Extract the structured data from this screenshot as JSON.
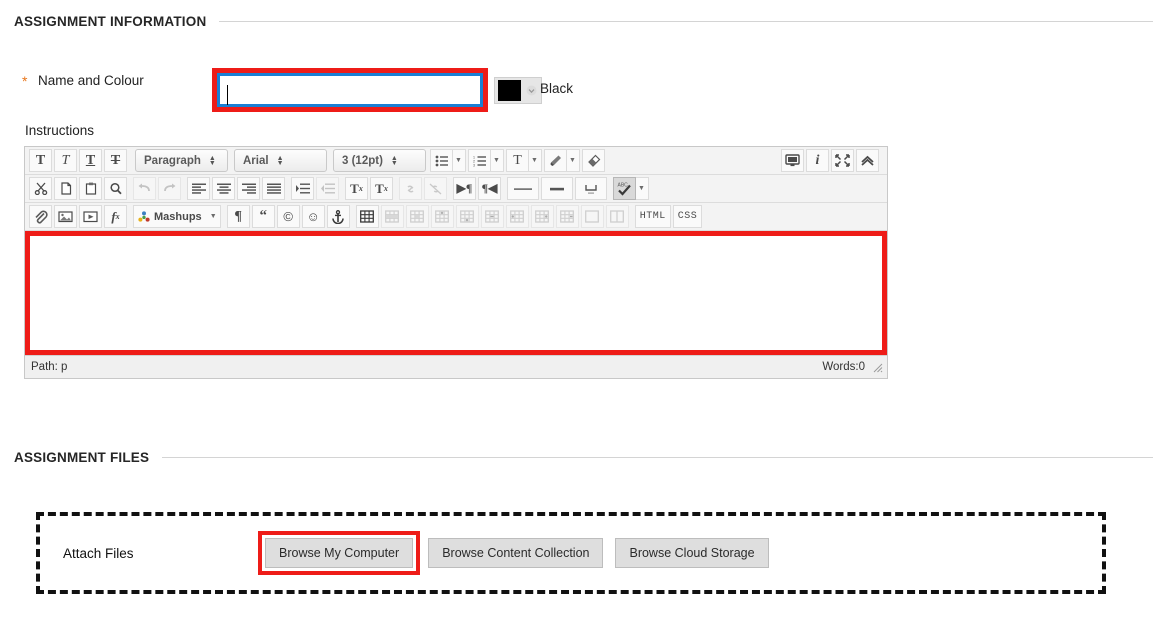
{
  "sections": {
    "assignment_information": "ASSIGNMENT INFORMATION",
    "assignment_files": "ASSIGNMENT FILES"
  },
  "name_field": {
    "required_marker": "*",
    "label": "Name and Colour",
    "value": "",
    "placeholder": ""
  },
  "color_picker": {
    "swatch_color": "#000000",
    "selected_label": "Black",
    "caret_icon": "chevron-down-icon"
  },
  "instructions": {
    "label": "Instructions"
  },
  "editor": {
    "row1": {
      "format_buttons": [
        {
          "name": "bold-icon",
          "glyph": "T"
        },
        {
          "name": "italic-icon",
          "glyph": "T"
        },
        {
          "name": "underline-icon",
          "glyph": "T"
        },
        {
          "name": "strikethrough-icon",
          "glyph": "T"
        }
      ],
      "paragraph_select": "Paragraph",
      "font_select": "Arial",
      "size_select": "3 (12pt)",
      "list_buttons": [
        {
          "name": "bullet-list-icon"
        },
        {
          "name": "numbered-list-icon"
        },
        {
          "name": "text-color-icon",
          "glyph": "T"
        },
        {
          "name": "highlighter-icon"
        },
        {
          "name": "eraser-icon"
        }
      ],
      "right_buttons": [
        {
          "name": "preview-monitor-icon"
        },
        {
          "name": "info-icon",
          "glyph": "i"
        },
        {
          "name": "fullscreen-icon"
        },
        {
          "name": "collapse-chevron-up-icon"
        }
      ]
    },
    "row2": {
      "buttons": [
        {
          "name": "cut-scissors-icon"
        },
        {
          "name": "copy-page-icon"
        },
        {
          "name": "paste-clipboard-icon"
        },
        {
          "name": "find-search-icon"
        },
        {
          "name": "undo-icon"
        },
        {
          "name": "redo-icon"
        },
        {
          "name": "align-left-icon"
        },
        {
          "name": "align-center-icon"
        },
        {
          "name": "align-right-icon"
        },
        {
          "name": "align-justify-icon"
        },
        {
          "name": "indent-icon"
        },
        {
          "name": "outdent-icon"
        },
        {
          "name": "superscript-icon"
        },
        {
          "name": "subscript-icon"
        },
        {
          "name": "insert-link-icon"
        },
        {
          "name": "remove-link-icon"
        },
        {
          "name": "ltr-direction-icon"
        },
        {
          "name": "rtl-direction-icon"
        },
        {
          "name": "horizontal-rule-icon"
        },
        {
          "name": "em-dash-icon"
        },
        {
          "name": "nonbreaking-space-icon"
        },
        {
          "name": "spellcheck-abc-icon"
        }
      ]
    },
    "row3": {
      "buttons": [
        {
          "name": "attach-paperclip-icon"
        },
        {
          "name": "insert-image-icon"
        },
        {
          "name": "insert-video-icon"
        },
        {
          "name": "math-formula-icon"
        }
      ],
      "mashups_label": "Mashups",
      "symbol_buttons": [
        {
          "name": "pilcrow-icon"
        },
        {
          "name": "blockquote-icon"
        },
        {
          "name": "copyright-icon"
        },
        {
          "name": "emoticon-icon"
        },
        {
          "name": "anchor-icon"
        }
      ],
      "table_buttons": [
        {
          "name": "insert-table-icon",
          "enabled": true
        },
        {
          "name": "table-row-properties-icon",
          "enabled": false
        },
        {
          "name": "table-cell-properties-icon",
          "enabled": false
        },
        {
          "name": "insert-row-before-icon",
          "enabled": false
        },
        {
          "name": "insert-row-after-icon",
          "enabled": false
        },
        {
          "name": "delete-row-icon",
          "enabled": false
        },
        {
          "name": "insert-column-before-icon",
          "enabled": false
        },
        {
          "name": "insert-column-after-icon",
          "enabled": false
        },
        {
          "name": "delete-column-icon",
          "enabled": false
        },
        {
          "name": "merge-cells-icon",
          "enabled": false
        },
        {
          "name": "split-cell-icon",
          "enabled": false
        }
      ],
      "html_label": "HTML",
      "css_label": "CSS"
    },
    "body_value": "",
    "statusbar": {
      "path": "Path: p",
      "words": "Words:0"
    }
  },
  "attach_files": {
    "label": "Attach Files",
    "buttons": [
      {
        "label": "Browse My Computer",
        "highlighted": true
      },
      {
        "label": "Browse Content Collection",
        "highlighted": false
      },
      {
        "label": "Browse Cloud Storage",
        "highlighted": false
      }
    ]
  },
  "colors": {
    "annotation_red": "#ee1c18",
    "focus_blue": "#1a7fd4",
    "required_orange": "#e8751a",
    "header_text": "#262626"
  }
}
